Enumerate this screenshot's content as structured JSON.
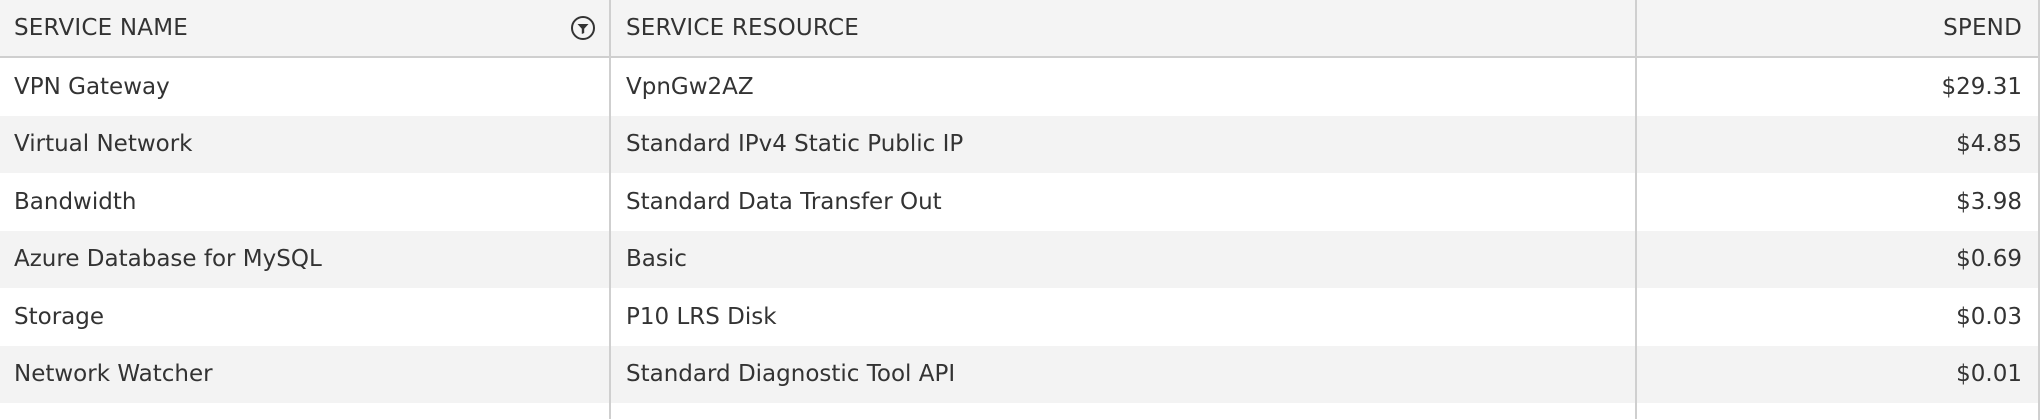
{
  "columns": {
    "service_name": "SERVICE NAME",
    "service_resource": "SERVICE RESOURCE",
    "spend": "SPEND"
  },
  "rows": [
    {
      "service_name": "VPN Gateway",
      "service_resource": "VpnGw2AZ",
      "spend": "$29.31"
    },
    {
      "service_name": "Virtual Network",
      "service_resource": "Standard IPv4 Static Public IP",
      "spend": "$4.85"
    },
    {
      "service_name": "Bandwidth",
      "service_resource": "Standard Data Transfer Out",
      "spend": "$3.98"
    },
    {
      "service_name": "Azure Database for MySQL",
      "service_resource": "Basic",
      "spend": "$0.69"
    },
    {
      "service_name": "Storage",
      "service_resource": "P10 LRS Disk",
      "spend": "$0.03"
    },
    {
      "service_name": "Network Watcher",
      "service_resource": "Standard Diagnostic Tool API",
      "spend": "$0.01"
    }
  ],
  "icons": {
    "filter": "filter-icon"
  }
}
